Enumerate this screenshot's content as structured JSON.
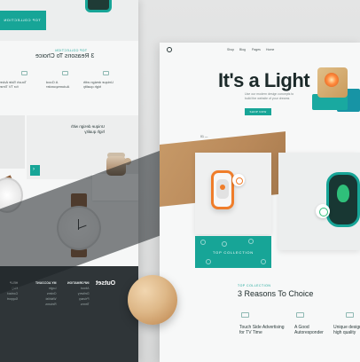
{
  "left_page": {
    "teal_card_label": "TOP COLLECTION",
    "section_label": "TOP COLLECTION",
    "section_title": "3 Reasons To Choice",
    "features": [
      {
        "text": "Touch Side Adve\nfor TV Time"
      },
      {
        "text": "A Good\nAutoresponder"
      },
      {
        "text": "Unique design with\nhigh quality"
      }
    ],
    "watch_card_text": "Unique design with\nhigh quality",
    "next_arrow": "›",
    "footer": {
      "logo": "Outset",
      "columns": [
        {
          "title": "INFORMATION",
          "items": [
            "About",
            "Delivery",
            "Privacy",
            "Terms"
          ]
        },
        {
          "title": "MY ACCOUNT",
          "items": [
            "Login",
            "Orders",
            "Wishlist",
            "Returns"
          ]
        },
        {
          "title": "HELP",
          "items": [
            "FAQ",
            "Contact",
            "Support"
          ]
        }
      ]
    }
  },
  "right_page": {
    "nav": [
      "Shop",
      "Blog",
      "Pages",
      "Home"
    ],
    "hero": {
      "title": "It's a Light",
      "subtitle": "Use our modern design concepts to build the website of your dreams",
      "button": "SHOP NOW"
    },
    "pager": "01 —",
    "collection_banner": "TOP COLLECTION",
    "section_label": "TOP COLLECTION",
    "section_title": "3 Reasons To Choice",
    "features": [
      {
        "text": "Touch Side Advertising\nfor TV Time"
      },
      {
        "text": "A Good\nAutoresponder"
      },
      {
        "text": "Unique design with\nhigh quality"
      }
    ]
  },
  "colors": {
    "accent": "#17a597",
    "orange": "#ef7d2a",
    "wood": "#c89560",
    "dark": "#2f3538"
  }
}
